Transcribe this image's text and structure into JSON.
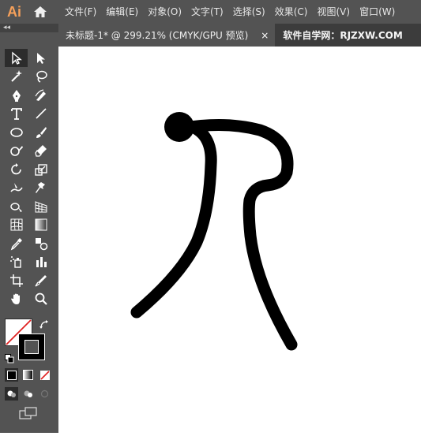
{
  "app": {
    "logo": "Ai"
  },
  "menu": {
    "items": [
      "文件(F)",
      "编辑(E)",
      "对象(O)",
      "文字(T)",
      "选择(S)",
      "效果(C)",
      "视图(V)",
      "窗口(W)"
    ]
  },
  "tab": {
    "document_title": "未标题-1* @ 299.21% (CMYK/GPU 预览)",
    "close_label": "×",
    "watermark": "软件自学网：RJZXW.COM"
  },
  "toolbar": {
    "collapse_label": "◂◂",
    "icons": [
      [
        "selection-tool-icon",
        "direct-selection-tool-icon"
      ],
      [
        "magic-wand-tool-icon",
        "lasso-tool-icon"
      ],
      [
        "pen-tool-icon",
        "curvature-tool-icon"
      ],
      [
        "type-tool-icon",
        "line-segment-tool-icon"
      ],
      [
        "ellipse-tool-icon",
        "paintbrush-tool-icon"
      ],
      [
        "shaper-tool-icon",
        "eraser-tool-icon"
      ],
      [
        "rotate-tool-icon",
        "scale-tool-icon"
      ],
      [
        "warp-tool-icon",
        "puppet-warp-tool-icon"
      ],
      [
        "shape-builder-tool-icon",
        "perspective-grid-tool-icon"
      ],
      [
        "mesh-tool-icon",
        "gradient-tool-icon"
      ],
      [
        "eyedropper-tool-icon",
        "blend-tool-icon"
      ],
      [
        "symbol-sprayer-tool-icon",
        "column-graph-tool-icon"
      ],
      [
        "artboard-tool-icon",
        "slice-tool-icon"
      ],
      [
        "hand-tool-icon",
        "zoom-tool-icon"
      ]
    ],
    "fill_color": "#ffffff",
    "stroke_color": "#000000"
  },
  "colors": {
    "menubar_bg": "#535353",
    "toolbar_bg": "#535353",
    "tabbar_bg": "#3c3c3c",
    "accent_logo": "#f5a05a",
    "artwork_stroke": "#000000"
  }
}
